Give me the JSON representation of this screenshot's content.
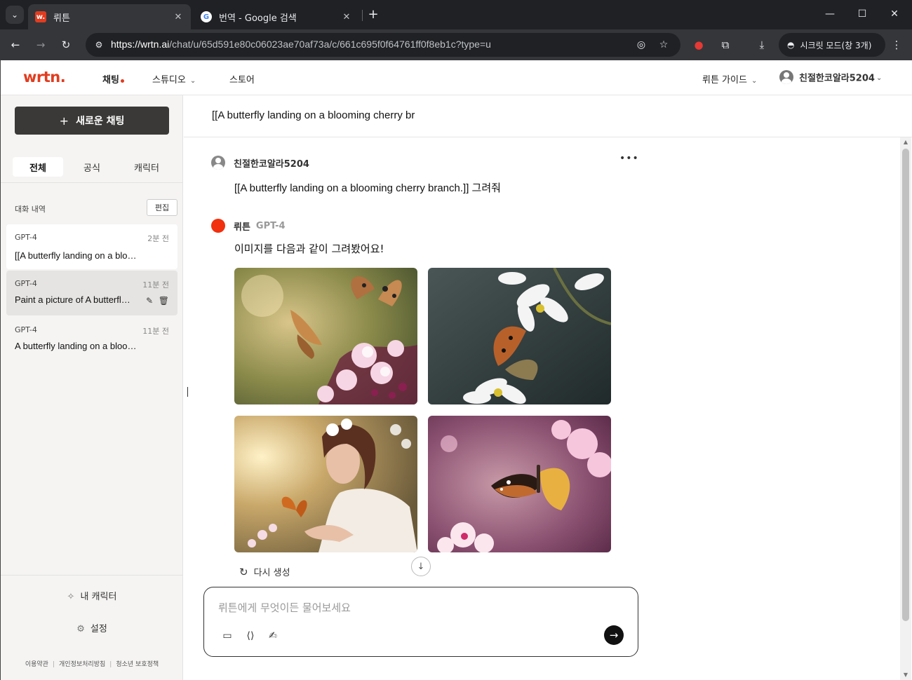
{
  "browser": {
    "tabs": [
      {
        "title": "뤼튼",
        "active": true,
        "favicon": "wrtn-favicon"
      },
      {
        "title": "번역 - Google 검색",
        "active": false,
        "favicon": "google-favicon"
      }
    ],
    "url_host": "https://wrtn.ai",
    "url_rest": "/chat/u/65d591e80c06023ae70af73a/c/661c695f0f64761ff0f8eb1c?type=u",
    "incognito_label": "시크릿 모드(창 3개)"
  },
  "topnav": {
    "logo": "wrtn.",
    "items": [
      {
        "label": "채팅",
        "active": true
      },
      {
        "label": "스튜디오",
        "has_dropdown": true
      },
      {
        "label": "스토어"
      }
    ],
    "guide": "뤼튼 가이드",
    "user": "친절한코알라5204"
  },
  "sidebar": {
    "new_chat": "새로운 채팅",
    "filter_tabs": [
      "전체",
      "공식",
      "캐릭터"
    ],
    "history_label": "대화 내역",
    "edit_label": "편집",
    "history": [
      {
        "model": "GPT-4",
        "time": "2분 전",
        "title": "[[A butterfly landing on a blooming cherry branch.]] 그려줘"
      },
      {
        "model": "GPT-4",
        "time": "11분 전",
        "title": "Paint a picture of A butterfly landing on a blooming cherry branch"
      },
      {
        "model": "GPT-4",
        "time": "11분 전",
        "title": "A butterfly landing on a blooming cherry branch"
      }
    ],
    "my_character": "내 캐릭터",
    "settings": "설정",
    "footer": [
      "이용약관",
      "개인정보처리방침",
      "청소년 보호정책"
    ]
  },
  "chat": {
    "title": "[[A butterfly landing on a blooming cherry br",
    "user_name": "친절한코알라5204",
    "user_message": "[[A butterfly landing on a blooming cherry branch.]] 그려줘",
    "bot_name": "뤼튼",
    "bot_model": "GPT-4",
    "bot_message": "이미지를 다음과 같이 그려봤어요!",
    "images": [
      "butterfly-cherry-image-1",
      "butterfly-white-flower-image-2",
      "woman-butterfly-image-3",
      "butterfly-pink-blossom-image-4"
    ],
    "regenerate": "다시 생성",
    "input_placeholder": "뤼튼에게 무엇이든 물어보세요"
  },
  "colors": {
    "brand": "#e13c1f",
    "sidebar_bg": "#f5f4f3",
    "new_chat_bg": "#3a3937"
  }
}
